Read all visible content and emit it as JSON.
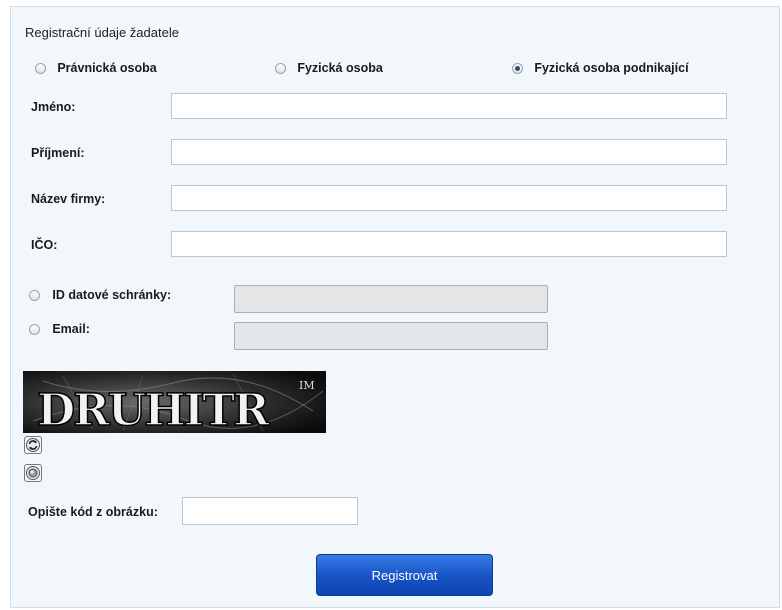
{
  "form": {
    "title": "Registrační údaje žadatele",
    "applicant_types": [
      {
        "label": "Právnická osoba",
        "selected": false
      },
      {
        "label": "Fyzická osoba",
        "selected": false
      },
      {
        "label": "Fyzická osoba podnikající",
        "selected": true
      }
    ],
    "fields": {
      "first_name_label": "Jméno:",
      "last_name_label": "Příjmení:",
      "company_label": "Název firmy:",
      "ico_label": "IČO:",
      "first_name_value": "",
      "last_name_value": "",
      "company_value": "",
      "ico_value": ""
    },
    "contact": {
      "databox_label": "ID datové schránky:",
      "email_label": "Email:"
    },
    "captcha": {
      "image_text": "DRUHITR",
      "corner_mark": "IM",
      "prompt_label": "Opište kód z obrázku:",
      "value": ""
    },
    "submit_label": "Registrovat"
  },
  "colors": {
    "panel_bg": "#f2f7fb",
    "panel_border": "#cfe0ec",
    "button_blue": "#1652c6"
  }
}
